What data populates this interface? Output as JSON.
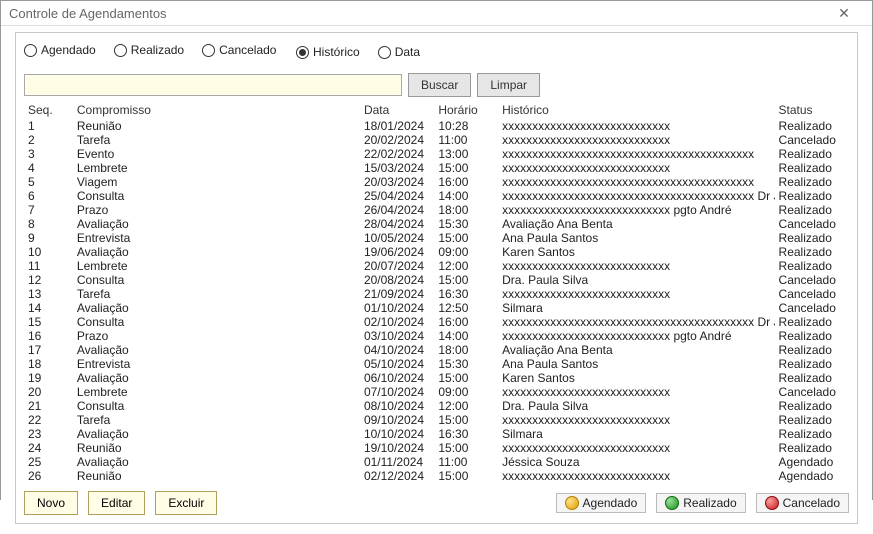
{
  "window": {
    "title": "Controle de Agendamentos"
  },
  "filters": {
    "agendado": "Agendado",
    "realizado": "Realizado",
    "cancelado": "Cancelado",
    "historico": "Histórico",
    "data": "Data",
    "selected_view": "historico"
  },
  "search": {
    "value": "",
    "buscar": "Buscar",
    "limpar": "Limpar"
  },
  "columns": {
    "seq": "Seq.",
    "compromisso": "Compromisso",
    "data": "Data",
    "horario": "Horário",
    "historico": "Histórico",
    "status": "Status"
  },
  "rows": [
    {
      "seq": "1",
      "comp": "Reunião",
      "data": "18/01/2024",
      "hora": "10:28",
      "hist": "xxxxxxxxxxxxxxxxxxxxxxxxxxxx",
      "status": "Realizado"
    },
    {
      "seq": "2",
      "comp": "Tarefa",
      "data": "20/02/2024",
      "hora": "11:00",
      "hist": "xxxxxxxxxxxxxxxxxxxxxxxxxxxx",
      "status": "Cancelado"
    },
    {
      "seq": "3",
      "comp": "Evento",
      "data": "22/02/2024",
      "hora": "13:00",
      "hist": "xxxxxxxxxxxxxxxxxxxxxxxxxxxxxxxxxxxxxxxxxx",
      "status": "Realizado"
    },
    {
      "seq": "4",
      "comp": "Lembrete",
      "data": "15/03/2024",
      "hora": "15:00",
      "hist": "xxxxxxxxxxxxxxxxxxxxxxxxxxxx",
      "status": "Realizado"
    },
    {
      "seq": "5",
      "comp": "Viagem",
      "data": "20/03/2024",
      "hora": "16:00",
      "hist": "xxxxxxxxxxxxxxxxxxxxxxxxxxxxxxxxxxxxxxxxxx",
      "status": "Realizado"
    },
    {
      "seq": "6",
      "comp": "Consulta",
      "data": "25/04/2024",
      "hora": "14:00",
      "hist": "xxxxxxxxxxxxxxxxxxxxxxxxxxxxxxxxxxxxxxxxxx Dr João",
      "status": "Realizado"
    },
    {
      "seq": "7",
      "comp": "Prazo",
      "data": "26/04/2024",
      "hora": "18:00",
      "hist": "xxxxxxxxxxxxxxxxxxxxxxxxxxxx pgto André",
      "status": "Realizado"
    },
    {
      "seq": "8",
      "comp": "Avaliação",
      "data": "28/04/2024",
      "hora": "15:30",
      "hist": "Avaliação Ana Benta",
      "status": "Cancelado"
    },
    {
      "seq": "9",
      "comp": "Entrevista",
      "data": "10/05/2024",
      "hora": "15:00",
      "hist": "Ana Paula Santos",
      "status": "Realizado"
    },
    {
      "seq": "10",
      "comp": "Avaliação",
      "data": "19/06/2024",
      "hora": "09:00",
      "hist": "Karen Santos",
      "status": "Realizado"
    },
    {
      "seq": "11",
      "comp": "Lembrete",
      "data": "20/07/2024",
      "hora": "12:00",
      "hist": "xxxxxxxxxxxxxxxxxxxxxxxxxxxx",
      "status": "Realizado"
    },
    {
      "seq": "12",
      "comp": "Consulta",
      "data": "20/08/2024",
      "hora": "15:00",
      "hist": "Dra. Paula Silva",
      "status": "Cancelado"
    },
    {
      "seq": "13",
      "comp": "Tarefa",
      "data": "21/09/2024",
      "hora": "16:30",
      "hist": "xxxxxxxxxxxxxxxxxxxxxxxxxxxx",
      "status": "Cancelado"
    },
    {
      "seq": "14",
      "comp": "Avaliação",
      "data": "01/10/2024",
      "hora": "12:50",
      "hist": "Silmara",
      "status": "Cancelado"
    },
    {
      "seq": "15",
      "comp": "Consulta",
      "data": "02/10/2024",
      "hora": "16:00",
      "hist": "xxxxxxxxxxxxxxxxxxxxxxxxxxxxxxxxxxxxxxxxxx Dr João",
      "status": "Realizado"
    },
    {
      "seq": "16",
      "comp": "Prazo",
      "data": "03/10/2024",
      "hora": "14:00",
      "hist": "xxxxxxxxxxxxxxxxxxxxxxxxxxxx pgto André",
      "status": "Realizado"
    },
    {
      "seq": "17",
      "comp": "Avaliação",
      "data": "04/10/2024",
      "hora": "18:00",
      "hist": "Avaliação Ana Benta",
      "status": "Realizado"
    },
    {
      "seq": "18",
      "comp": "Entrevista",
      "data": "05/10/2024",
      "hora": "15:30",
      "hist": "Ana Paula Santos",
      "status": "Realizado"
    },
    {
      "seq": "19",
      "comp": "Avaliação",
      "data": "06/10/2024",
      "hora": "15:00",
      "hist": "Karen Santos",
      "status": "Realizado"
    },
    {
      "seq": "20",
      "comp": "Lembrete",
      "data": "07/10/2024",
      "hora": "09:00",
      "hist": "xxxxxxxxxxxxxxxxxxxxxxxxxxxx",
      "status": "Cancelado"
    },
    {
      "seq": "21",
      "comp": "Consulta",
      "data": "08/10/2024",
      "hora": "12:00",
      "hist": "Dra. Paula Silva",
      "status": "Realizado"
    },
    {
      "seq": "22",
      "comp": "Tarefa",
      "data": "09/10/2024",
      "hora": "15:00",
      "hist": "xxxxxxxxxxxxxxxxxxxxxxxxxxxx",
      "status": "Realizado"
    },
    {
      "seq": "23",
      "comp": "Avaliação",
      "data": "10/10/2024",
      "hora": "16:30",
      "hist": "Silmara",
      "status": "Realizado"
    },
    {
      "seq": "24",
      "comp": "Reunião",
      "data": "19/10/2024",
      "hora": "15:00",
      "hist": "xxxxxxxxxxxxxxxxxxxxxxxxxxxx",
      "status": "Realizado"
    },
    {
      "seq": "25",
      "comp": "Avaliação",
      "data": "01/11/2024",
      "hora": "11:00",
      "hist": "Jéssica Souza",
      "status": "Agendado"
    },
    {
      "seq": "26",
      "comp": "Reunião",
      "data": "02/12/2024",
      "hora": "15:00",
      "hist": "xxxxxxxxxxxxxxxxxxxxxxxxxxxx",
      "status": "Agendado"
    }
  ],
  "footer": {
    "novo": "Novo",
    "editar": "Editar",
    "excluir": "Excluir"
  },
  "legend": {
    "agendado": "Agendado",
    "realizado": "Realizado",
    "cancelado": "Cancelado"
  }
}
